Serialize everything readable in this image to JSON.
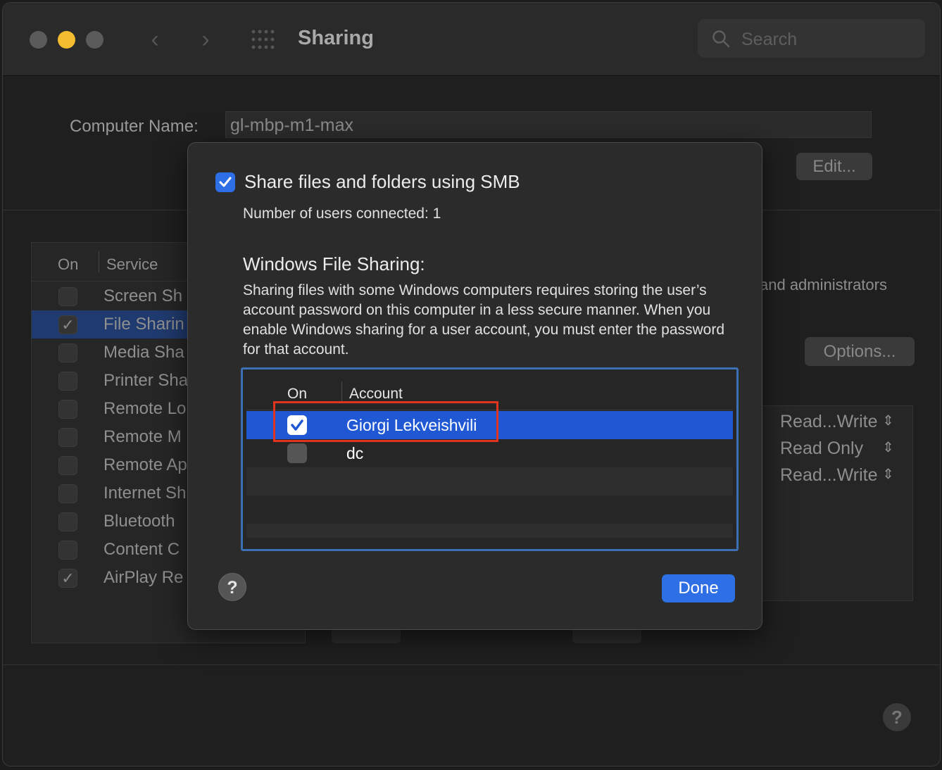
{
  "window": {
    "title": "Sharing",
    "search_placeholder": "Search"
  },
  "computer_name": {
    "label": "Computer Name:",
    "value": "gl-mbp-m1-max",
    "edit_label": "Edit..."
  },
  "services": {
    "col_on": "On",
    "col_service": "Service",
    "items": [
      {
        "label": "Screen Sh",
        "checked": false,
        "selected": false
      },
      {
        "label": "File Sharin",
        "checked": true,
        "selected": true
      },
      {
        "label": "Media Sha",
        "checked": false,
        "selected": false
      },
      {
        "label": "Printer Sha",
        "checked": false,
        "selected": false
      },
      {
        "label": "Remote Lo",
        "checked": false,
        "selected": false
      },
      {
        "label": "Remote M",
        "checked": false,
        "selected": false
      },
      {
        "label": "Remote Ap",
        "checked": false,
        "selected": false
      },
      {
        "label": "Internet Sh",
        "checked": false,
        "selected": false
      },
      {
        "label": "Bluetooth",
        "checked": false,
        "selected": false
      },
      {
        "label": "Content C",
        "checked": false,
        "selected": false
      },
      {
        "label": "AirPlay Re",
        "checked": true,
        "selected": false
      }
    ]
  },
  "background": {
    "admins_text": "and administrators",
    "options_label": "Options...",
    "permissions": [
      "Read...Write",
      "Read Only",
      "Read...Write"
    ]
  },
  "sheet": {
    "smb_label": "Share files and folders using SMB",
    "smb_checked": true,
    "users_connected": "Number of users connected: 1",
    "wfs_title": "Windows File Sharing:",
    "wfs_description": "Sharing files with some Windows computers requires storing the user’s account password on this computer in a less secure manner. When you enable Windows sharing for a user account, you must enter the password for that account.",
    "table": {
      "col_on": "On",
      "col_account": "Account",
      "rows": [
        {
          "name": "Giorgi Lekveishvili",
          "checked": true
        },
        {
          "name": "dc",
          "checked": false
        }
      ]
    },
    "help_label": "?",
    "done_label": "Done"
  },
  "bottom_help_label": "?",
  "colors": {
    "accent": "#2f6fe6",
    "selection": "#2058d4",
    "highlight_box": "#e0341f"
  }
}
